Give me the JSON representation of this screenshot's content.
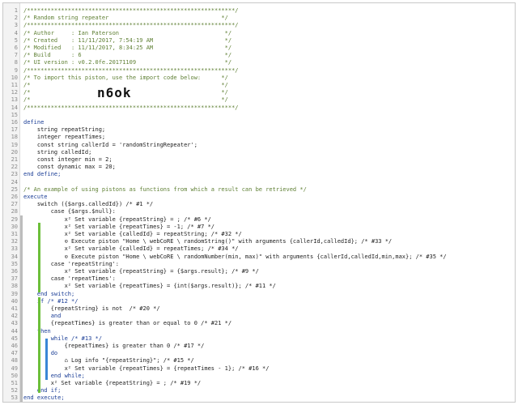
{
  "lines": [
    {
      "n": "1",
      "t": "/*************************************************************/",
      "cls": "c"
    },
    {
      "n": "2",
      "t": "/* Random string repeater                                 */",
      "cls": "c"
    },
    {
      "n": "3",
      "t": "/*************************************************************/",
      "cls": "c"
    },
    {
      "n": "4",
      "t": "/* Author     : Ian Paterson                               */",
      "cls": "c"
    },
    {
      "n": "5",
      "t": "/* Created    : 11/11/2017, 7:54:19 AM                     */",
      "cls": "c"
    },
    {
      "n": "6",
      "t": "/* Modified   : 11/11/2017, 8:34:25 AM                     */",
      "cls": "c"
    },
    {
      "n": "7",
      "t": "/* Build      : 6                                          */",
      "cls": "c"
    },
    {
      "n": "8",
      "t": "/* UI version : v0.2.0fe.20171109                          */",
      "cls": "c"
    },
    {
      "n": "9",
      "t": "/*************************************************************/",
      "cls": "c"
    },
    {
      "n": "10",
      "t": "/* To import this piston, use the import code below:      */",
      "cls": "c"
    },
    {
      "n": "11",
      "t": "/*                                                        */",
      "cls": "c"
    },
    {
      "n": "12",
      "t": "/*                                                        */",
      "cls": "c"
    },
    {
      "n": "13",
      "t": "/*                                                        */",
      "cls": "c"
    },
    {
      "n": "14",
      "t": "/*************************************************************/",
      "cls": "c"
    },
    {
      "n": "15",
      "t": "",
      "cls": "p"
    },
    {
      "n": "16",
      "t": "define",
      "cls": "k"
    },
    {
      "n": "17",
      "t": "    string repeatString;",
      "cls": "p"
    },
    {
      "n": "18",
      "t": "    integer repeatTimes;",
      "cls": "p"
    },
    {
      "n": "19",
      "t": "    const string callerId = 'randomStringRepeater';",
      "cls": "p"
    },
    {
      "n": "20",
      "t": "    string calledId;",
      "cls": "p"
    },
    {
      "n": "21",
      "t": "    const integer min = 2;",
      "cls": "p"
    },
    {
      "n": "22",
      "t": "    const dynamic max = 20;",
      "cls": "p"
    },
    {
      "n": "23",
      "t": "end define;",
      "cls": "k"
    },
    {
      "n": "24",
      "t": "",
      "cls": "p"
    },
    {
      "n": "25",
      "t": "/* An example of using pistons as functions from which a result can be retrieved */",
      "cls": "c"
    },
    {
      "n": "26",
      "t": "execute",
      "cls": "k"
    },
    {
      "n": "27",
      "t": "    switch ({$args.calledId}) /* #1 */",
      "cls": "p"
    },
    {
      "n": "28",
      "t": "        case {$args.$null}:",
      "cls": "p"
    },
    {
      "n": "29",
      "t": "            x² Set variable {repeatString} = ; /* #6 */",
      "cls": "p"
    },
    {
      "n": "30",
      "t": "            x² Set variable {repeatTimes} = -1; /* #7 */",
      "cls": "p"
    },
    {
      "n": "31",
      "t": "            x² Set variable {calledId} = repeatString; /* #32 */",
      "cls": "p"
    },
    {
      "n": "32",
      "t": "            ⊙ Execute piston \"Home \\ webCoRE \\ randomString()\" with arguments {callerId,calledId}; /* #33 */",
      "cls": "p"
    },
    {
      "n": "33",
      "t": "            x² Set variable {calledId} = repeatTimes; /* #34 */",
      "cls": "p"
    },
    {
      "n": "34",
      "t": "            ⊙ Execute piston \"Home \\ webCoRE \\ randomNumber(min, max)\" with arguments {callerId,calledId,min,max}; /* #35 */",
      "cls": "p"
    },
    {
      "n": "35",
      "t": "        case 'repeatString':",
      "cls": "p"
    },
    {
      "n": "36",
      "t": "            x² Set variable {repeatString} = {$args.result}; /* #9 */",
      "cls": "p"
    },
    {
      "n": "37",
      "t": "        case 'repeatTimes':",
      "cls": "p"
    },
    {
      "n": "38",
      "t": "            x² Set variable {repeatTimes} = {int($args.result)}; /* #11 */",
      "cls": "p"
    },
    {
      "n": "39",
      "t": "    end switch;",
      "cls": "k"
    },
    {
      "n": "40",
      "t": "    if /* #12 */",
      "cls": "k"
    },
    {
      "n": "41",
      "t": "        {repeatString} is not  /* #20 */",
      "cls": "p"
    },
    {
      "n": "42",
      "t": "        and",
      "cls": "k"
    },
    {
      "n": "43",
      "t": "        {repeatTimes} is greater than or equal to 0 /* #21 */",
      "cls": "p"
    },
    {
      "n": "44",
      "t": "    then",
      "cls": "k"
    },
    {
      "n": "45",
      "t": "        while /* #13 */",
      "cls": "k"
    },
    {
      "n": "46",
      "t": "            {repeatTimes} is greater than 0 /* #17 */",
      "cls": "p"
    },
    {
      "n": "47",
      "t": "        do",
      "cls": "k"
    },
    {
      "n": "48",
      "t": "            ⌂ Log info \"{repeatString}\"; /* #15 */",
      "cls": "p"
    },
    {
      "n": "49",
      "t": "            x² Set variable {repeatTimes} = {repeatTimes - 1}; /* #16 */",
      "cls": "p"
    },
    {
      "n": "50",
      "t": "        end while;",
      "cls": "k"
    },
    {
      "n": "51",
      "t": "        x² Set variable {repeatString} = ; /* #19 */",
      "cls": "p"
    },
    {
      "n": "52",
      "t": "    end if;",
      "cls": "k"
    },
    {
      "n": "53",
      "t": "end execute;",
      "cls": "k"
    }
  ],
  "import_code": "n6ok"
}
